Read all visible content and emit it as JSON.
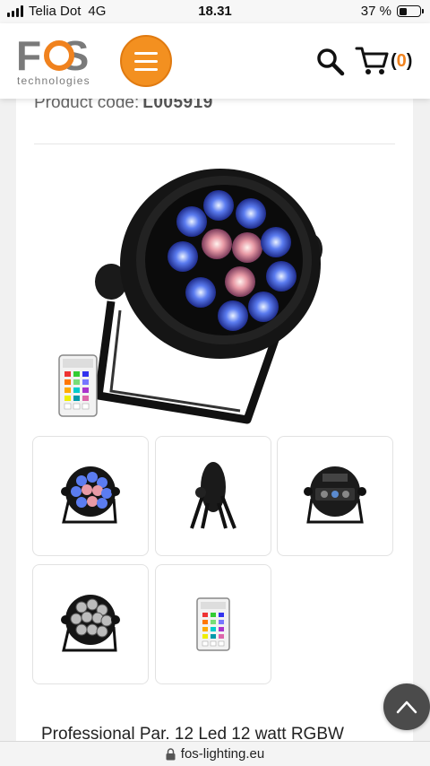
{
  "status_bar": {
    "carrier": "Telia Dot",
    "network": "4G",
    "time": "18.31",
    "battery_percent": "37 %",
    "battery_level": 0.37
  },
  "header": {
    "logo_text": "FOS",
    "logo_subtext": "technologies",
    "menu_icon": "hamburger-icon",
    "search_icon": "search-icon",
    "cart_icon": "cart-icon",
    "cart_count": "0",
    "accent_color": "#f0821e"
  },
  "product": {
    "code_label": "Product code:",
    "code_value": "L005919",
    "title": "Professional Par. 12 Led 12 watt RGBW"
  },
  "thumbnails": [
    {
      "label": "front-lit-view"
    },
    {
      "label": "side-view"
    },
    {
      "label": "rear-view"
    },
    {
      "label": "front-unlit-view"
    },
    {
      "label": "remote-control"
    }
  ],
  "browser": {
    "url": "fos-lighting.eu",
    "lock_icon": "lock-icon"
  },
  "scroll_top_icon": "chevron-up-icon"
}
